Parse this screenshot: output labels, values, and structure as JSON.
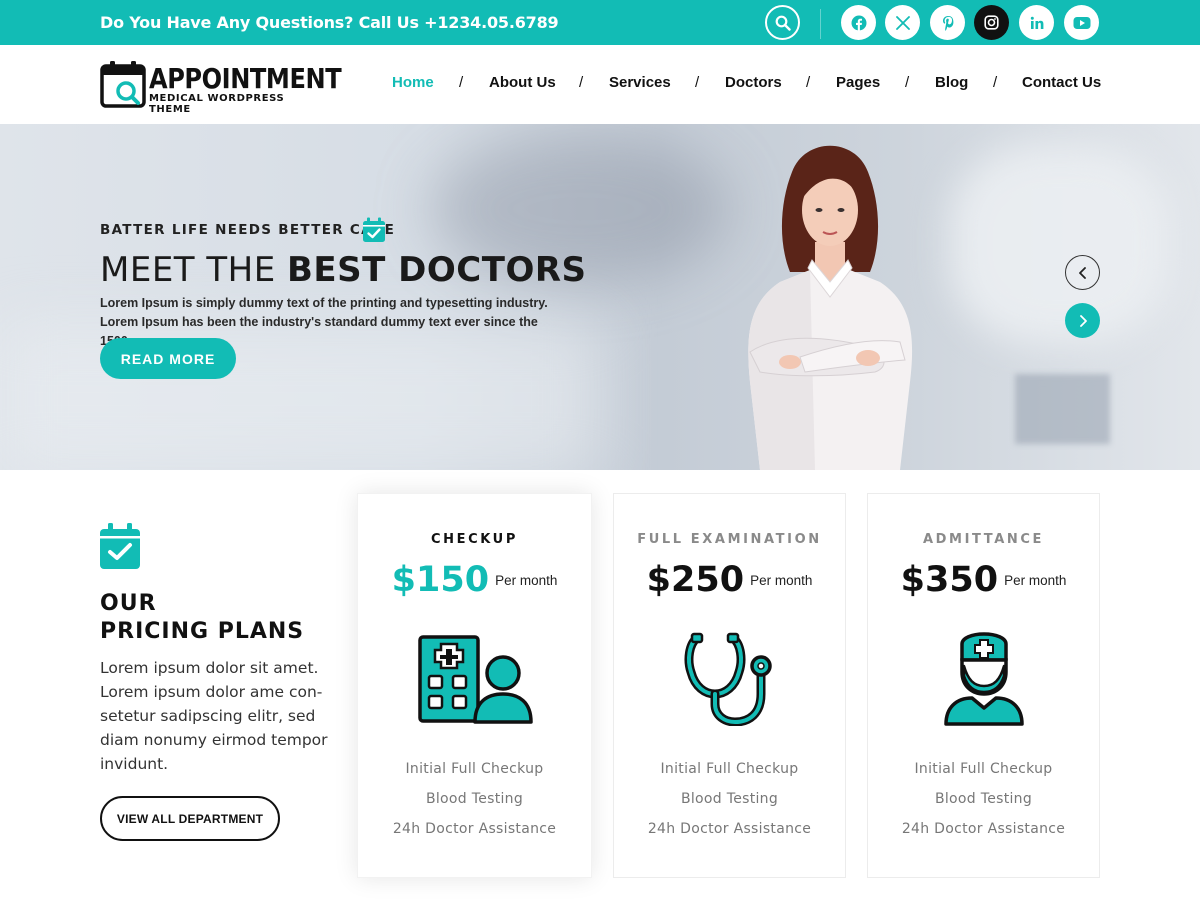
{
  "topbar": {
    "question": "Do You Have Any Questions? Call Us +1234.05.6789",
    "social": [
      "facebook-icon",
      "x-icon",
      "pinterest-icon",
      "instagram-icon",
      "linkedin-icon",
      "youtube-icon"
    ]
  },
  "logo": {
    "title": "APPOINTMENT",
    "subtitle": "MEDICAL WORDPRESS THEME"
  },
  "nav": {
    "items": [
      "Home",
      "About Us",
      "Services",
      "Doctors",
      "Pages",
      "Blog",
      "Contact Us"
    ],
    "separator": "/",
    "active": "Home"
  },
  "hero": {
    "tagline": "BATTER LIFE NEEDS BETTER CARE",
    "headline_light": "MEET THE",
    "headline_bold": "BEST DOCTORS",
    "description": "Lorem Ipsum is simply dummy text of the printing and typesetting industry. Lorem Ipsum has been the industry's standard dummy text ever since the 1500s.",
    "cta": "READ MORE"
  },
  "pricing_intro": {
    "title_line1": "OUR",
    "title_line2": "PRICING PLANS",
    "text": "Lorem ipsum dolor sit amet. Lorem ipsum dolor ame con-setetur sadipscing elitr, sed diam nonumy eirmod tempor invidunt.",
    "button": "VIEW ALL DEPARTMENT"
  },
  "plans": [
    {
      "name": "CHECKUP",
      "price": "$150",
      "period": "Per month",
      "icon": "hospital-patient-icon",
      "features": [
        "Initial Full Checkup",
        "Blood Testing",
        "24h Doctor Assistance"
      ]
    },
    {
      "name": "FULL EXAMINATION",
      "price": "$250",
      "period": "Per month",
      "icon": "stethoscope-icon",
      "features": [
        "Initial Full Checkup",
        "Blood Testing",
        "24h Doctor Assistance"
      ]
    },
    {
      "name": "ADMITTANCE",
      "price": "$350",
      "period": "Per month",
      "icon": "doctor-icon",
      "features": [
        "Initial Full Checkup",
        "Blood Testing",
        "24h Doctor Assistance"
      ]
    }
  ],
  "colors": {
    "accent": "#12bcb5",
    "text": "#111111",
    "muted": "#777777"
  }
}
